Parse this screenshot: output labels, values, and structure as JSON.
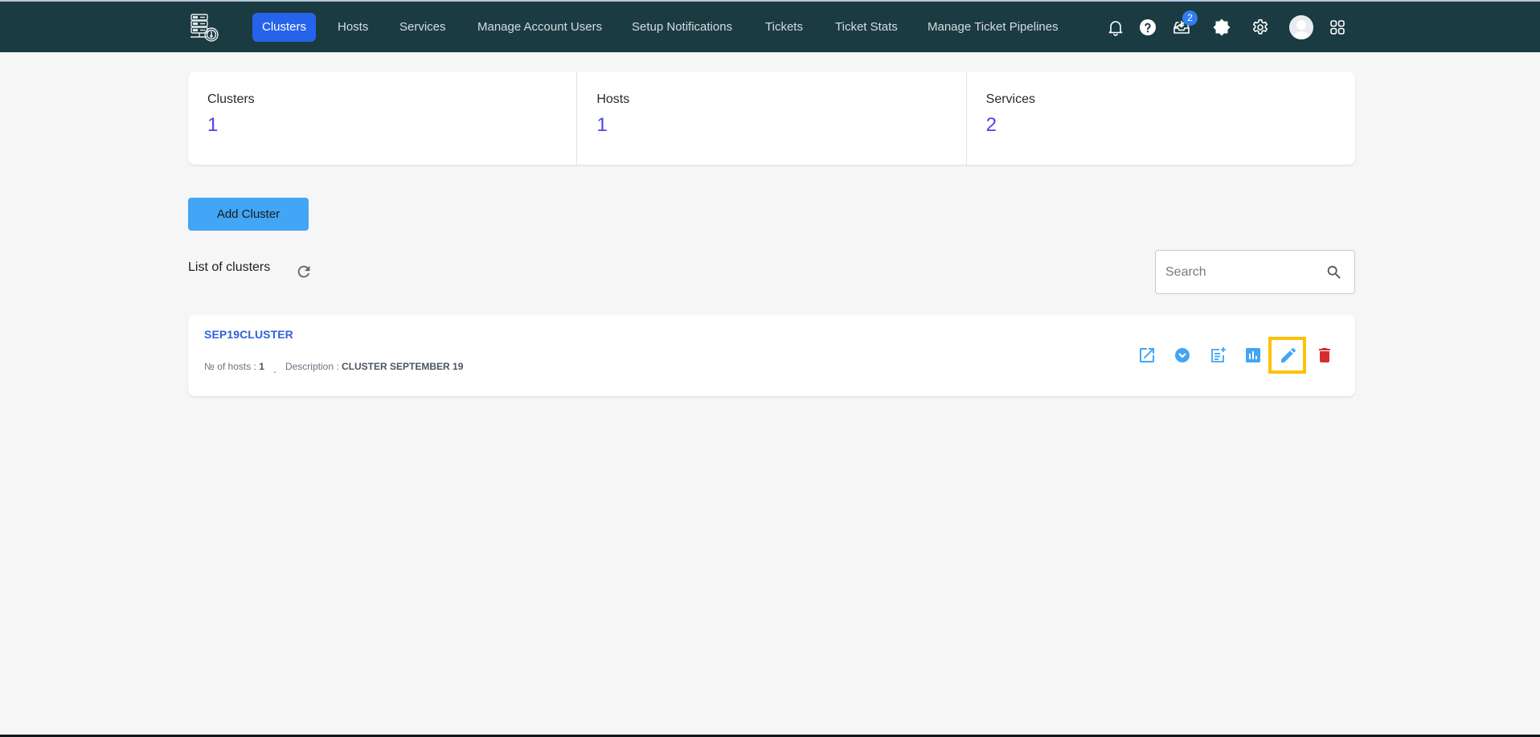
{
  "navbar": {
    "logo": "server-monitoring-logo",
    "items": [
      {
        "label": "Clusters",
        "active": true
      },
      {
        "label": "Hosts",
        "active": false
      },
      {
        "label": "Services",
        "active": false
      },
      {
        "label": "Manage Account Users",
        "active": false
      },
      {
        "label": "Setup Notifications",
        "active": false
      },
      {
        "label": "Tickets",
        "active": false
      },
      {
        "label": "Ticket Stats",
        "active": false
      },
      {
        "label": "Manage Ticket Pipelines",
        "active": false
      }
    ],
    "icons": [
      "bell-icon",
      "help-icon",
      "inbox-icon",
      "theme-toggle-icon",
      "settings-icon",
      "avatar",
      "apps-grid-icon"
    ],
    "inbox_badge": "2",
    "colors": {
      "background": "#1b3b42",
      "active": "#2563eb"
    }
  },
  "stats": [
    {
      "label": "Clusters",
      "value": "1"
    },
    {
      "label": "Hosts",
      "value": "1"
    },
    {
      "label": "Services",
      "value": "2"
    }
  ],
  "add_button": {
    "label": "Add Cluster",
    "color": "#42a5f5"
  },
  "list": {
    "title": "List of clusters",
    "refresh_icon": "refresh-icon",
    "search": {
      "placeholder": "Search",
      "value": ""
    }
  },
  "clusters": [
    {
      "name": "SEP19CLUSTER",
      "hosts_label": "№ of hosts :",
      "hosts_value": "1",
      "separator": ".",
      "description_label": "Description :",
      "description_value": "CLUSTER SEPTEMBER 19",
      "actions": [
        {
          "name": "open-external-icon",
          "color": "#42a5f5"
        },
        {
          "name": "expand-icon",
          "color": "#42a5f5"
        },
        {
          "name": "add-note-icon",
          "color": "#42a5f5"
        },
        {
          "name": "stats-chart-icon",
          "color": "#42a5f5"
        },
        {
          "name": "edit-icon",
          "color": "#42a5f5",
          "highlighted": true
        },
        {
          "name": "delete-icon",
          "color": "#d32f2f"
        }
      ]
    }
  ]
}
